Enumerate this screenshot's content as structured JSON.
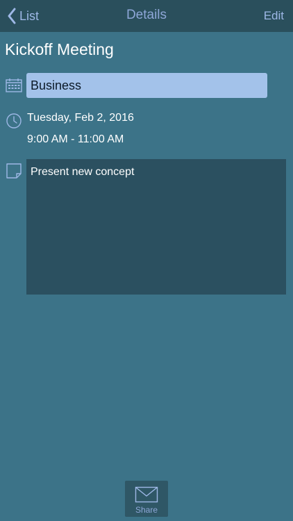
{
  "nav": {
    "back_label": "List",
    "title": "Details",
    "edit_label": "Edit"
  },
  "event": {
    "title": "Kickoff Meeting",
    "category": "Business",
    "date": "Tuesday, Feb 2, 2016",
    "time": "9:00 AM - 11:00 AM",
    "notes": "Present new concept"
  },
  "toolbar": {
    "share_label": "Share"
  },
  "icons": {
    "back": "chevron-left-icon",
    "category": "calendar-icon",
    "time": "clock-icon",
    "notes": "note-icon",
    "share": "envelope-icon"
  },
  "colors": {
    "background": "#3c7388",
    "navbar": "#2a4f5c",
    "accent": "#9eb8e6",
    "category_field": "#a3c2ea",
    "notes_box": "#2b5060"
  }
}
